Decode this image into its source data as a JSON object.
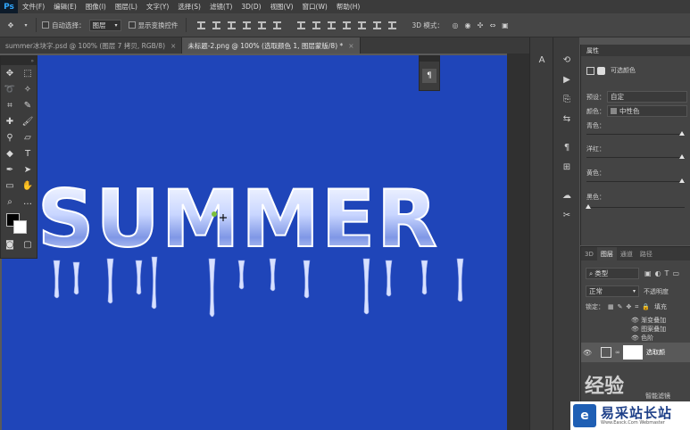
{
  "menu": {
    "logo": "Ps",
    "items": [
      "文件(F)",
      "编辑(E)",
      "图像(I)",
      "图层(L)",
      "文字(Y)",
      "选择(S)",
      "滤镜(T)",
      "3D(D)",
      "视图(V)",
      "窗口(W)",
      "帮助(H)"
    ]
  },
  "options": {
    "auto_select_label": "自动选择：",
    "auto_select_value": "图层",
    "show_transform_label": "显示变换控件",
    "mode_3d_label": "3D 模式："
  },
  "tabs": [
    {
      "label": "summer冰块字.psd @ 100% (图层 7 拷贝, RGB/8)",
      "close": "×"
    },
    {
      "label": "未标题-2.png @ 100% (选取颜色 1, 图层蒙版/8) *",
      "close": "×"
    }
  ],
  "canvas": {
    "text": "SUMMER",
    "bg_color": "#1f45b9"
  },
  "properties": {
    "panel_title": "属性",
    "layer_name": "可选颜色",
    "preset_label": "预设：",
    "preset_value": "自定",
    "colors_label": "颜色：",
    "colors_value": "中性色",
    "cyan_label": "青色：",
    "magenta_label": "洋红：",
    "yellow_label": "黄色：",
    "black_label": "黑色："
  },
  "layers": {
    "tabs": [
      "3D",
      "图层",
      "通道",
      "路径"
    ],
    "kind_value": "类型",
    "blend_value": "正常",
    "opacity_label": "不透明度",
    "lock_label": "锁定：",
    "fill_label": "填充",
    "effects": [
      "渐变叠加",
      "图案叠加",
      "色阶"
    ],
    "selected_layer": "选取颜",
    "filter_label": "智能滤镜"
  },
  "watermark": {
    "logo": "e",
    "title": "易采站长站",
    "url": "Www.Easck.Com Webmaster",
    "jingyan": "经验"
  }
}
